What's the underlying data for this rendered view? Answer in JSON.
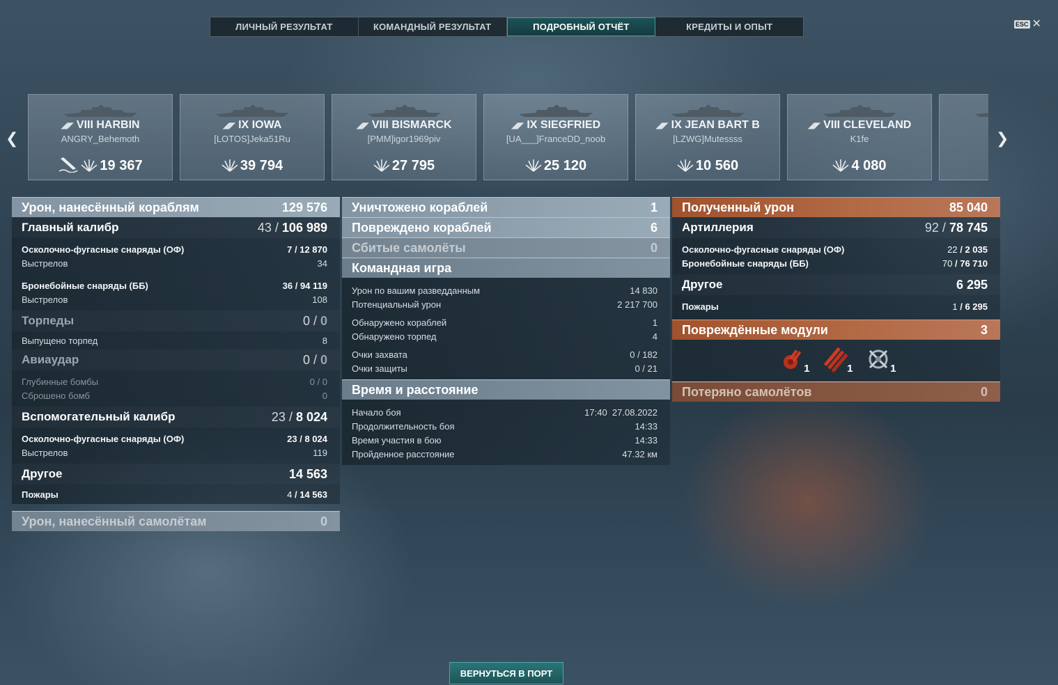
{
  "tabs": [
    "ЛИЧНЫЙ РЕЗУЛЬТАТ",
    "КОМАНДНЫЙ РЕЗУЛЬТАТ",
    "ПОДРОБНЫЙ ОТЧЁТ",
    "КРЕДИТЫ И ОПЫТ"
  ],
  "active_tab": "ПОДРОБНЫЙ ОТЧЁТ",
  "esc_label": "ESC",
  "ships": [
    {
      "tier": "VIII",
      "name": "HARBIN",
      "player": "ANGRY_Behemoth",
      "damage": "19 367",
      "sunk": true
    },
    {
      "tier": "IX",
      "name": "IOWA",
      "player": "[LOTOS]Jeka51Ru",
      "damage": "39 794"
    },
    {
      "tier": "VIII",
      "name": "BISMARCK",
      "player": "[PMM]igor1969piv",
      "damage": "27 795"
    },
    {
      "tier": "IX",
      "name": "SIEGFRIED",
      "player": "[UA___]FranceDD_noob",
      "damage": "25 120"
    },
    {
      "tier": "IX",
      "name": "JEAN BART B",
      "player": "[LZWG]Mutessss",
      "damage": "10 560"
    },
    {
      "tier": "VIII",
      "name": "CLEVELAND",
      "player": "K1fe",
      "damage": "4 080"
    },
    {
      "tier": "",
      "name": "",
      "player": "[C",
      "damage": ""
    }
  ],
  "left": {
    "header": {
      "label": "Урон, нанесённый кораблям",
      "value": "129 576"
    },
    "main_caliber": {
      "label": "Главный калибр",
      "hits": "43",
      "value": "106 989"
    },
    "he": {
      "label": "Осколочно-фугасные снаряды (ОФ)",
      "hits": "7",
      "value": "12 870"
    },
    "he_shots": {
      "label": "Выстрелов",
      "value": "34"
    },
    "ap": {
      "label": "Бронебойные снаряды (ББ)",
      "hits": "36",
      "value": "94 119"
    },
    "ap_shots": {
      "label": "Выстрелов",
      "value": "108"
    },
    "torpedoes": {
      "label": "Торпеды",
      "hits": "0",
      "value": "0"
    },
    "torps_launched": {
      "label": "Выпущено торпед",
      "value": "8"
    },
    "airstrike": {
      "label": "Авиаудар",
      "hits": "0",
      "value": "0"
    },
    "depth_charges": {
      "label": "Глубинные бомбы",
      "hits": "0",
      "value": "0"
    },
    "bombs_dropped": {
      "label": "Сброшено бомб",
      "value": "0"
    },
    "secondary": {
      "label": "Вспомогательный калибр",
      "hits": "23",
      "value": "8 024"
    },
    "sec_he": {
      "label": "Осколочно-фугасные снаряды (ОФ)",
      "hits": "23",
      "value": "8 024"
    },
    "sec_shots": {
      "label": "Выстрелов",
      "value": "119"
    },
    "other": {
      "label": "Другое",
      "value": "14 563"
    },
    "fires": {
      "label": "Пожары",
      "hits": "4",
      "value": "14 563"
    },
    "aircraft_damage": {
      "label": "Урон, нанесённый самолётам",
      "value": "0"
    }
  },
  "middle": {
    "destroyed": {
      "label": "Уничтожено кораблей",
      "value": "1"
    },
    "damaged": {
      "label": "Повреждено кораблей",
      "value": "6"
    },
    "planes_shot": {
      "label": "Сбитые самолёты",
      "value": "0"
    },
    "teamplay": {
      "label": "Командная игра"
    },
    "spotting_damage": {
      "label": "Урон по вашим разведданным",
      "value": "14 830"
    },
    "potential_damage": {
      "label": "Потенциальный урон",
      "value": "2 217 700"
    },
    "ships_spotted": {
      "label": "Обнаружено кораблей",
      "value": "1"
    },
    "torps_spotted": {
      "label": "Обнаружено торпед",
      "value": "4"
    },
    "capture_points": {
      "label": "Очки захвата",
      "value": "0 / 182"
    },
    "defense_points": {
      "label": "Очки защиты",
      "value": "0 / 21"
    },
    "time_distance": {
      "label": "Время и расстояние"
    },
    "battle_start": {
      "label": "Начало боя",
      "value": "17:40  27.08.2022"
    },
    "battle_duration": {
      "label": "Продолжительность боя",
      "value": "14:33"
    },
    "participation": {
      "label": "Время участия в бою",
      "value": "14:33"
    },
    "distance": {
      "label": "Пройденное расстояние",
      "value": "47.32 км"
    }
  },
  "right": {
    "received": {
      "label": "Полученный урон",
      "value": "85 040"
    },
    "artillery": {
      "label": "Артиллерия",
      "hits": "92",
      "value": "78 745"
    },
    "he": {
      "label": "Осколочно-фугасные снаряды (ОФ)",
      "hits": "22",
      "value": "2 035"
    },
    "ap": {
      "label": "Бронебойные снаряды (ББ)",
      "hits": "70",
      "value": "76 710"
    },
    "other": {
      "label": "Другое",
      "value": "6 295"
    },
    "fires": {
      "label": "Пожары",
      "hits": "1",
      "value": "6 295"
    },
    "modules": {
      "label": "Повреждённые модули",
      "value": "3"
    },
    "module_items": [
      {
        "icon": "turret-icon",
        "count": "1"
      },
      {
        "icon": "torpedo-tubes-icon",
        "count": "1"
      },
      {
        "icon": "steering-gear-icon",
        "count": "1"
      }
    ],
    "planes_lost": {
      "label": "Потеряно самолётов",
      "value": "0"
    }
  },
  "return_button": "ВЕРНУТЬСЯ В ПОРТ",
  "colors": {
    "accent_teal": "#1d5257",
    "received_orange": "#a0522d"
  }
}
